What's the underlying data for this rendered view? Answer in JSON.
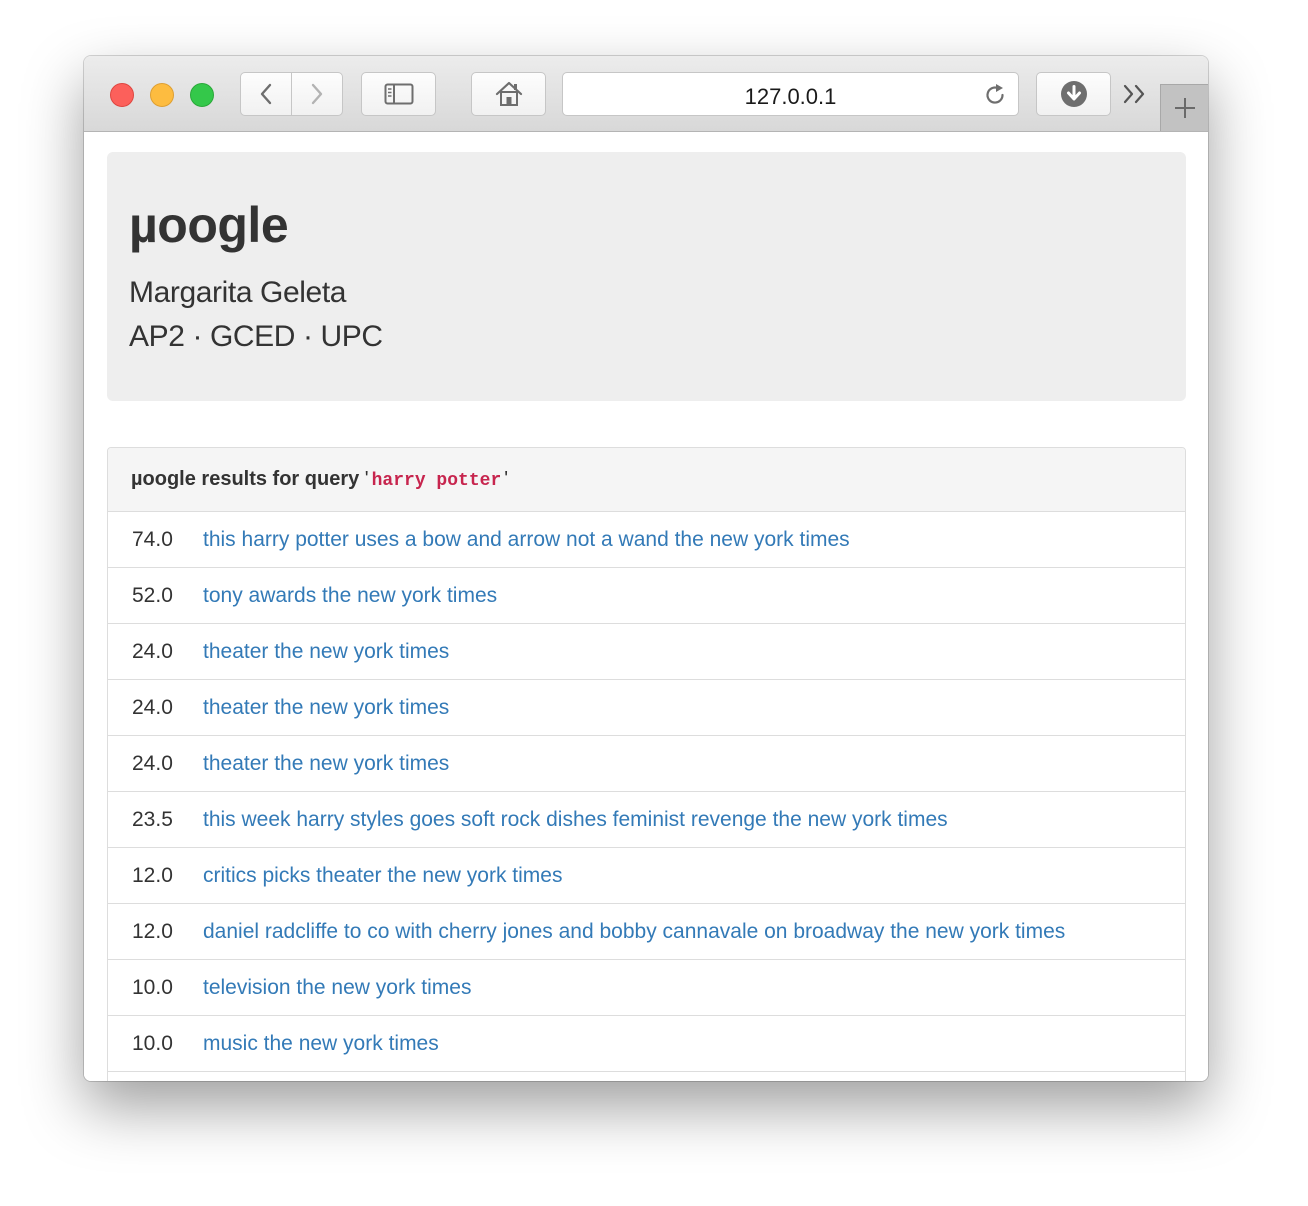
{
  "browser": {
    "url": "127.0.0.1",
    "icons": {
      "close": "close-dot",
      "minimize": "minimize-dot",
      "zoom": "zoom-dot",
      "back": "chevron-left-icon",
      "forward": "chevron-right-icon",
      "sidebar": "sidebar-icon",
      "home": "home-icon",
      "reload": "reload-icon",
      "downloads": "download-icon",
      "overflow": "double-chevron-icon",
      "new_tab": "plus-icon"
    }
  },
  "header": {
    "title": "µoogle",
    "author": "Margarita Geleta",
    "affiliation": "AP2 · GCED · UPC"
  },
  "results": {
    "heading_prefix": "µoogle results for query",
    "quote_open": "'",
    "query": "harry potter",
    "quote_close": "'",
    "items": [
      {
        "score": "74.0",
        "title": "this harry potter uses a bow and arrow not a wand the new york times"
      },
      {
        "score": "52.0",
        "title": "tony awards the new york times"
      },
      {
        "score": "24.0",
        "title": "theater the new york times"
      },
      {
        "score": "24.0",
        "title": "theater the new york times"
      },
      {
        "score": "24.0",
        "title": "theater the new york times"
      },
      {
        "score": "23.5",
        "title": "this week harry styles goes soft rock dishes feminist revenge the new york times"
      },
      {
        "score": "12.0",
        "title": "critics picks theater the new york times"
      },
      {
        "score": "12.0",
        "title": "daniel radcliffe to co with cherry jones and bobby cannavale on broadway the new york times"
      },
      {
        "score": "10.0",
        "title": "television the new york times"
      },
      {
        "score": "10.0",
        "title": "music the new york times"
      }
    ]
  },
  "colors": {
    "link": "#337ab7",
    "query_code": "#c7254e",
    "jumbotron_bg": "#eeeeee",
    "panel_heading_bg": "#f5f5f5"
  }
}
